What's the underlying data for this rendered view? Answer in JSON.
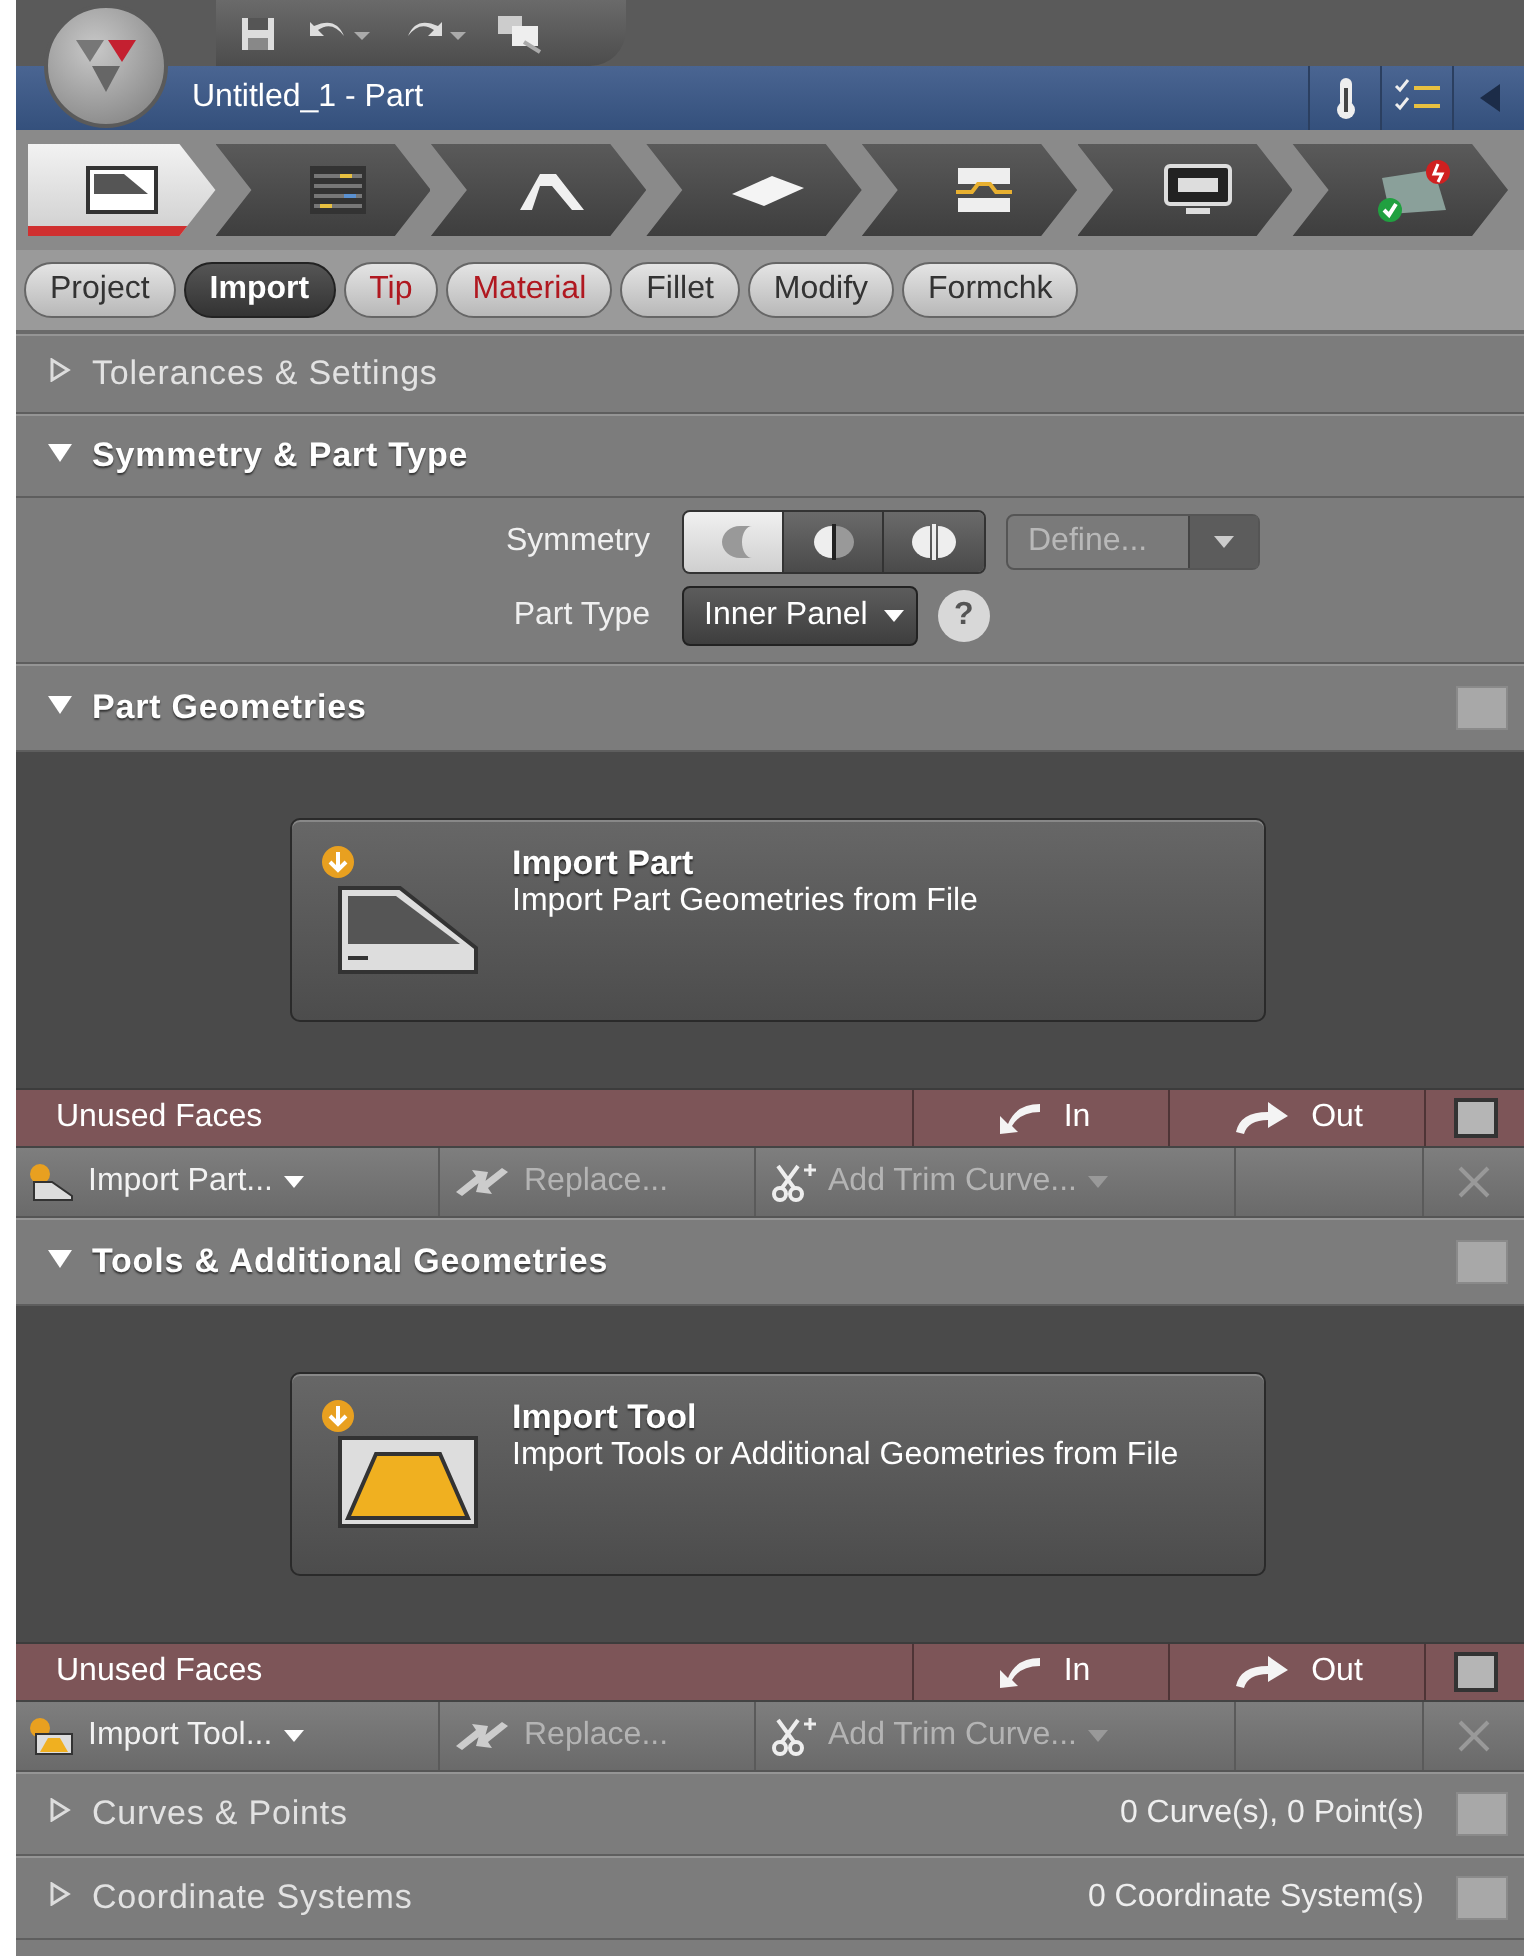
{
  "window": {
    "title": "Untitled_1 - Part"
  },
  "workflow_steps": [
    {
      "kind": "part",
      "selected": true
    },
    {
      "kind": "table",
      "selected": false
    },
    {
      "kind": "profile",
      "selected": false
    },
    {
      "kind": "plate",
      "selected": false
    },
    {
      "kind": "tool",
      "selected": false
    },
    {
      "kind": "monitor",
      "selected": false
    },
    {
      "kind": "check",
      "selected": false
    }
  ],
  "tabs": [
    {
      "label": "Project",
      "selected": false,
      "warning": false
    },
    {
      "label": "Import",
      "selected": true,
      "warning": false
    },
    {
      "label": "Tip",
      "selected": false,
      "warning": true
    },
    {
      "label": "Material",
      "selected": false,
      "warning": true
    },
    {
      "label": "Fillet",
      "selected": false,
      "warning": false
    },
    {
      "label": "Modify",
      "selected": false,
      "warning": false
    },
    {
      "label": "Formchk",
      "selected": false,
      "warning": false
    }
  ],
  "tolerances": {
    "title": "Tolerances & Settings",
    "expanded": false
  },
  "symmetry": {
    "title": "Symmetry & Part Type",
    "expanded": true,
    "symmetry_label": "Symmetry",
    "options": [
      {
        "kind": "none",
        "selected": true
      },
      {
        "kind": "half",
        "selected": false
      },
      {
        "kind": "full",
        "selected": false
      }
    ],
    "define": {
      "label": "Define...",
      "disabled": true
    },
    "part_type_label": "Part Type",
    "part_type": "Inner Panel",
    "help": "?"
  },
  "part_geometries": {
    "title": "Part Geometries",
    "expanded": true,
    "card": {
      "kind": "part",
      "title": "Import Part",
      "subtitle": "Import Part Geometries from File"
    },
    "unused": {
      "label": "Unused Faces",
      "in": "In",
      "out": "Out",
      "checked": false
    },
    "toolbar": {
      "import": "Import Part...",
      "replace": "Replace...",
      "add_trim": "Add Trim Curve..."
    }
  },
  "tools": {
    "title": "Tools & Additional Geometries",
    "expanded": true,
    "card": {
      "kind": "tool",
      "title": "Import Tool",
      "subtitle": "Import Tools or Additional Geometries from File"
    },
    "unused": {
      "label": "Unused Faces",
      "in": "In",
      "out": "Out",
      "checked": false
    },
    "toolbar": {
      "import": "Import Tool...",
      "replace": "Replace...",
      "add_trim": "Add Trim Curve..."
    }
  },
  "curves": {
    "title": "Curves & Points",
    "expanded": false,
    "summary": "0 Curve(s), 0 Point(s)"
  },
  "coordinates": {
    "title": "Coordinate Systems",
    "expanded": false,
    "summary": "0 Coordinate System(s)"
  }
}
